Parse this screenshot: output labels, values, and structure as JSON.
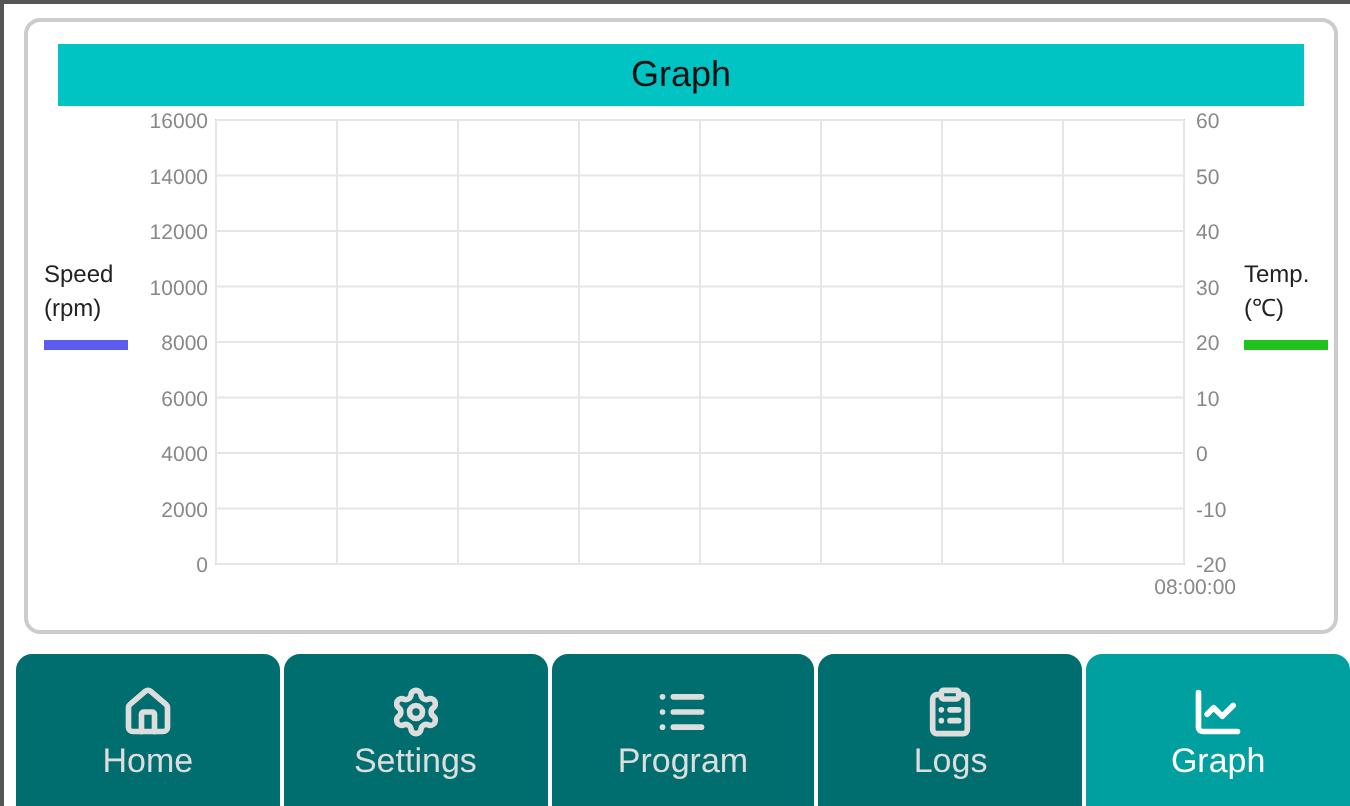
{
  "title": "Graph",
  "chart": {
    "chart_data": {
      "type": "line",
      "grid": true,
      "ylim": [
        0,
        16000
      ],
      "yticks": [
        0,
        2000,
        4000,
        6000,
        8000,
        10000,
        12000,
        14000,
        16000
      ],
      "series": [
        {
          "name": "Speed\n(rpm)",
          "color": "#5b5bf0"
        },
        {
          "name": "Temp.\n(℃)",
          "color": "#1ec31e"
        }
      ]
    },
    "right_axis_ticks": [
      "60",
      "50",
      "40",
      "30",
      "20",
      "10",
      "0",
      "-10",
      "-20"
    ],
    "time_label": "08:00:00"
  },
  "tabs": [
    {
      "label": "Home",
      "selected": false
    },
    {
      "label": "Settings",
      "selected": false
    },
    {
      "label": "Program",
      "selected": false
    },
    {
      "label": "Logs",
      "selected": false
    },
    {
      "label": "Graph",
      "selected": true
    }
  ]
}
